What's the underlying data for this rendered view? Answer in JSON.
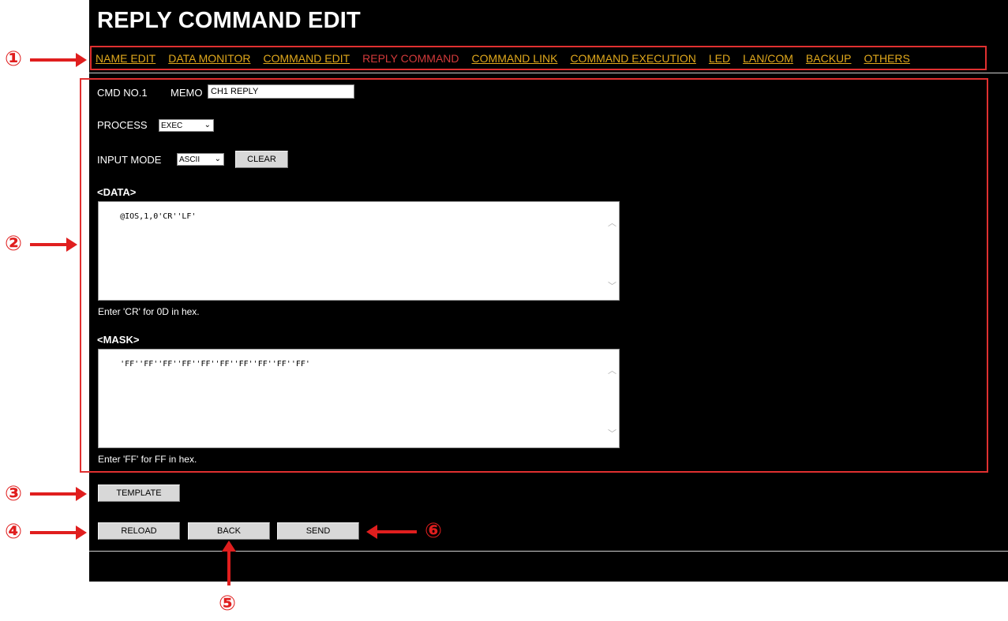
{
  "page": {
    "title": "REPLY COMMAND EDIT"
  },
  "nav": [
    {
      "label": "NAME EDIT",
      "active": false
    },
    {
      "label": "DATA MONITOR",
      "active": false
    },
    {
      "label": "COMMAND EDIT",
      "active": false
    },
    {
      "label": "REPLY COMMAND",
      "active": true
    },
    {
      "label": "COMMAND LINK",
      "active": false
    },
    {
      "label": "COMMAND EXECUTION",
      "active": false
    },
    {
      "label": "LED",
      "active": false
    },
    {
      "label": "LAN/COM",
      "active": false
    },
    {
      "label": "BACKUP",
      "active": false
    },
    {
      "label": "OTHERS",
      "active": false
    }
  ],
  "form": {
    "cmd_no_label": "CMD NO.1",
    "memo_label": "MEMO",
    "memo_value": "CH1 REPLY",
    "process_label": "PROCESS",
    "process_value": "EXEC",
    "input_mode_label": "INPUT MODE",
    "input_mode_value": "ASCII",
    "clear_label": "CLEAR",
    "data_title": "<DATA>",
    "data_value": "@IOS,1,0'CR''LF'",
    "data_hint": "Enter 'CR' for 0D in hex.",
    "mask_title": "<MASK>",
    "mask_value": "'FF''FF''FF''FF''FF''FF''FF''FF''FF''FF'",
    "mask_hint": "Enter 'FF' for FF in hex."
  },
  "buttons": {
    "template": "TEMPLATE",
    "reload": "RELOAD",
    "back": "BACK",
    "send": "SEND"
  },
  "callouts": [
    "①",
    "②",
    "③",
    "④",
    "⑤",
    "⑥"
  ],
  "colors": {
    "accent_link": "#e0a81c",
    "active_link": "#d23a3a",
    "annotation": "#e01e1e"
  },
  "icons": {
    "select_arrow": "chevron-down-icon",
    "scroll_up": "chevron-up-icon",
    "scroll_down": "chevron-down-icon"
  }
}
